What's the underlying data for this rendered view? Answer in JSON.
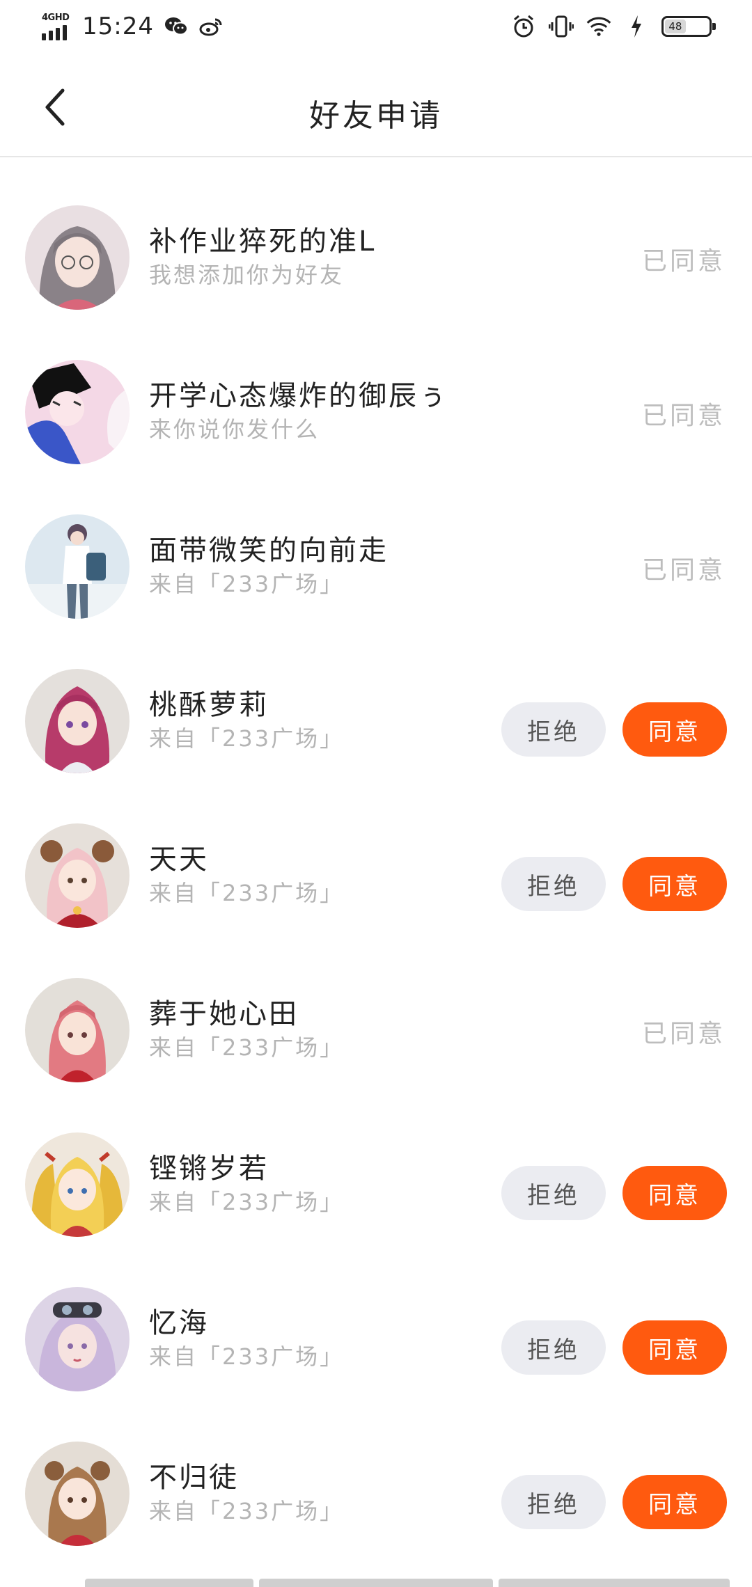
{
  "status_bar": {
    "network": "4GHD",
    "time": "15:24",
    "battery": "48",
    "left_icons": [
      "wechat-icon",
      "weibo-icon"
    ],
    "right_icons": [
      "alarm-icon",
      "vibrate-icon",
      "wifi-icon",
      "charging-icon"
    ]
  },
  "header": {
    "title": "好友申请",
    "back_icon": "chevron-left-icon"
  },
  "colors": {
    "accent": "#ff5a0f",
    "reject_bg": "#ebecf1",
    "muted_text": "#bdbdbd"
  },
  "requests": [
    {
      "name": "补作业猝死的准L",
      "message": "我想添加你为好友",
      "state": "accepted",
      "status_label": "已同意",
      "avatar": "girl-glasses-gray-hair"
    },
    {
      "name": "开学心态爆炸的御辰ぅ",
      "message": "来你说你发什么",
      "state": "accepted",
      "status_label": "已同意",
      "avatar": "boy-dark-hair-pink"
    },
    {
      "name": "面带微笑的向前走",
      "message": "来自「233广场」",
      "state": "accepted",
      "status_label": "已同意",
      "avatar": "boy-backpack-sky"
    },
    {
      "name": "桃酥萝莉",
      "message": "来自「233广场」",
      "state": "pending",
      "reject_label": "拒绝",
      "agree_label": "同意",
      "avatar": "girl-magenta-hair"
    },
    {
      "name": "天天",
      "message": "来自「233广场」",
      "state": "pending",
      "reject_label": "拒绝",
      "agree_label": "同意",
      "avatar": "girl-pink-buns"
    },
    {
      "name": "葬于她心田",
      "message": "来自「233广场」",
      "state": "accepted",
      "status_label": "已同意",
      "avatar": "girl-pink-braids"
    },
    {
      "name": "铿锵岁若",
      "message": "来自「233广场」",
      "state": "pending",
      "reject_label": "拒绝",
      "agree_label": "同意",
      "avatar": "girl-blonde-twintails"
    },
    {
      "name": "忆海",
      "message": "来自「233广场」",
      "state": "pending",
      "reject_label": "拒绝",
      "agree_label": "同意",
      "avatar": "girl-lavender-goggles"
    },
    {
      "name": "不归徒",
      "message": "来自「233广场」",
      "state": "pending",
      "reject_label": "拒绝",
      "agree_label": "同意",
      "avatar": "girl-brown-buns"
    }
  ]
}
